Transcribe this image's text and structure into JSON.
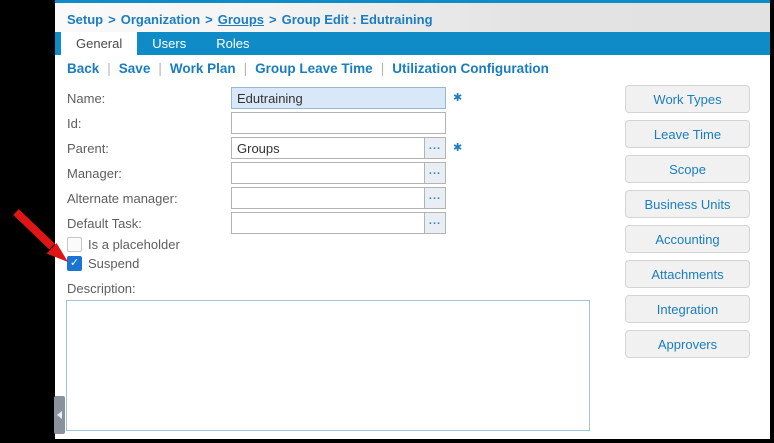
{
  "breadcrumb": {
    "items": [
      "Setup",
      "Organization",
      "Groups",
      "Group Edit : Edutraining"
    ],
    "separator": ">"
  },
  "tabs": [
    {
      "label": "General",
      "active": true
    },
    {
      "label": "Users",
      "active": false
    },
    {
      "label": "Roles",
      "active": false
    }
  ],
  "action_links": {
    "items": [
      "Back",
      "Save",
      "Work Plan",
      "Group Leave Time",
      "Utilization Configuration"
    ],
    "separator": "|"
  },
  "form": {
    "fields": [
      {
        "label": "Name:",
        "value": "Edutraining",
        "required": true,
        "picker": false,
        "highlighted": true
      },
      {
        "label": "Id:",
        "value": "",
        "required": false,
        "picker": false,
        "highlighted": false
      },
      {
        "label": "Parent:",
        "value": "Groups",
        "required": true,
        "picker": true,
        "highlighted": false
      },
      {
        "label": "Manager:",
        "value": "",
        "required": false,
        "picker": true,
        "highlighted": false
      },
      {
        "label": "Alternate manager:",
        "value": "",
        "required": false,
        "picker": true,
        "highlighted": false
      },
      {
        "label": "Default Task:",
        "value": "",
        "required": false,
        "picker": true,
        "highlighted": false
      }
    ],
    "checkboxes": [
      {
        "label": "Is a placeholder",
        "checked": false
      },
      {
        "label": "Suspend",
        "checked": true
      }
    ],
    "description_label": "Description:",
    "description_value": ""
  },
  "side_buttons": [
    "Work Types",
    "Leave Time",
    "Scope",
    "Business Units",
    "Accounting",
    "Attachments",
    "Integration",
    "Approvers"
  ],
  "glyphs": {
    "picker_button": "...",
    "required_marker": "✱",
    "check": "✓"
  },
  "colors": {
    "accent_blue": "#0f8cc7",
    "link_blue": "#1a7dc0",
    "checked_blue": "#1b74d2",
    "name_field_fill": "#d9e8f8",
    "annotation_arrow_red": "#e01515",
    "handle_gray": "#8a939d"
  }
}
